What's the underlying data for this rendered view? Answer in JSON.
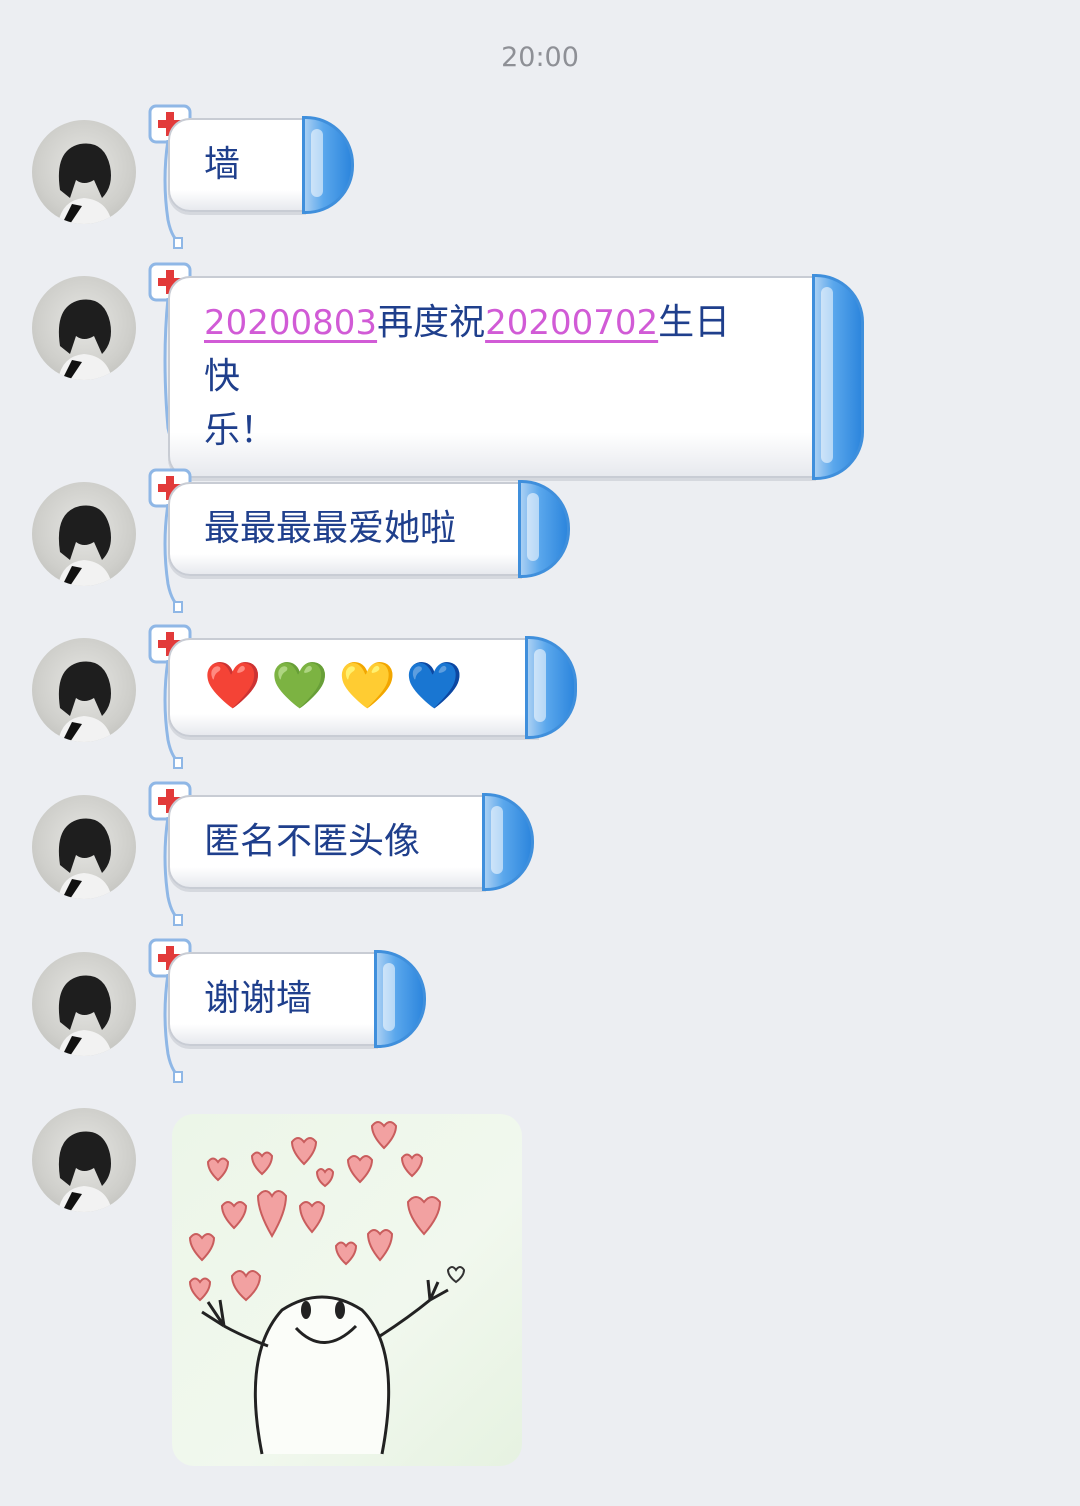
{
  "chat": {
    "timestamp": "20:00",
    "messages": [
      {
        "type": "text",
        "text": "墙"
      },
      {
        "type": "text",
        "parts": [
          "20200803",
          "再度祝",
          "20200702",
          "生日快",
          "乐！"
        ]
      },
      {
        "type": "text",
        "text": "最最最最爱她啦"
      },
      {
        "type": "emoji",
        "emojis": [
          "❤️",
          "💚",
          "💛",
          "💙"
        ]
      },
      {
        "type": "text",
        "text": "匿名不匿头像"
      },
      {
        "type": "text",
        "text": "谢谢墙"
      },
      {
        "type": "sticker",
        "icon": "hearts-joy-sticker"
      }
    ]
  },
  "colors": {
    "background": "#eceef2",
    "bubble_text": "#1f3f8c",
    "link": "#d15bd6",
    "cap_blue": "#3f8fdc"
  }
}
